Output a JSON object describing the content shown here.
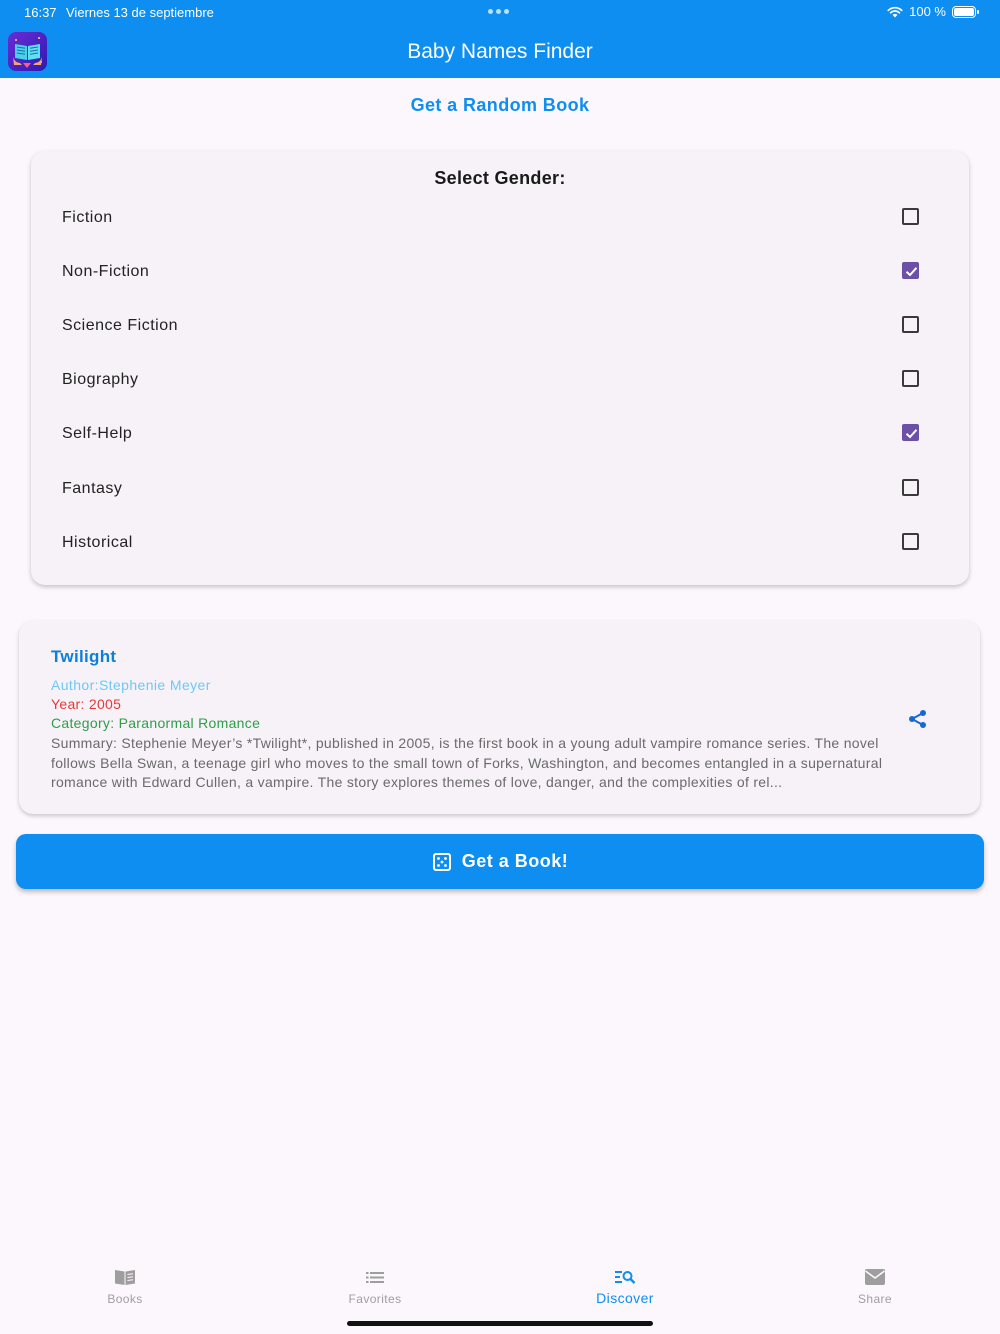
{
  "status_bar": {
    "time": "16:37",
    "date": "Viernes 13 de septiembre",
    "battery": "100 %",
    "battery_level": 1.0
  },
  "app_bar": {
    "title": "Baby Names Finder",
    "icon": "book-app-icon"
  },
  "page": {
    "heading": "Get a Random Book"
  },
  "gender_card": {
    "title": "Select Gender:",
    "options": [
      {
        "label": "Fiction",
        "checked": false
      },
      {
        "label": "Non-Fiction",
        "checked": true
      },
      {
        "label": "Science Fiction",
        "checked": false
      },
      {
        "label": "Biography",
        "checked": false
      },
      {
        "label": "Self-Help",
        "checked": true
      },
      {
        "label": "Fantasy",
        "checked": false
      },
      {
        "label": "Historical",
        "checked": false
      }
    ]
  },
  "book": {
    "title": "Twilight",
    "author": "Author:Stephenie Meyer",
    "year": "Year: 2005",
    "category": "Category: Paranormal Romance",
    "summary": "Summary: Stephenie Meyer’s *Twilight*, published in 2005, is the first book in a young adult vampire romance series. The novel follows Bella Swan, a teenage girl who moves to the small town of Forks, Washington, and becomes entangled in a supernatural romance with Edward Cullen, a vampire. The story explores themes of love, danger, and the complexities of rel..."
  },
  "action": {
    "get_book_label": "Get a Book!",
    "icon": "dice-icon"
  },
  "bottom_nav": {
    "items": [
      {
        "label": "Books",
        "icon": "book-icon",
        "active": false
      },
      {
        "label": "Favorites",
        "icon": "list-icon",
        "active": false
      },
      {
        "label": "Discover",
        "icon": "discover-icon",
        "active": true
      },
      {
        "label": "Share",
        "icon": "mail-icon",
        "active": false
      }
    ]
  },
  "colors": {
    "primary": "#0d8ef0",
    "checkbox_checked": "#6b4fa8",
    "background": "#fcf7fd",
    "author": "#6ec8f5",
    "year": "#e53935",
    "category": "#2e9e48"
  }
}
